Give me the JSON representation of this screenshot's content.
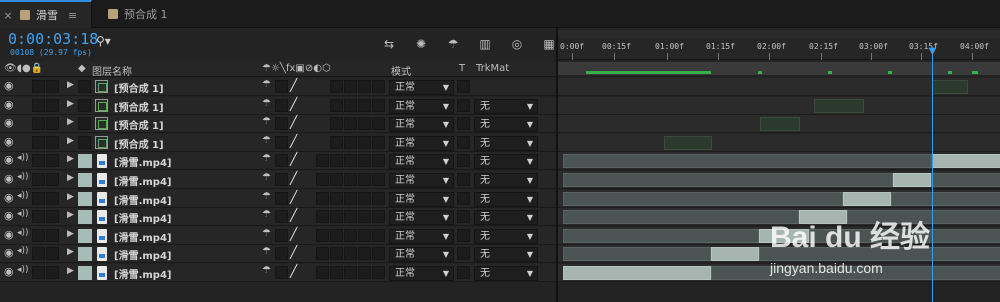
{
  "tabs": [
    {
      "label": "滑雪",
      "close": "×",
      "menu": "≡"
    },
    {
      "label": "预合成 1"
    }
  ],
  "header": {
    "timecode": "0:00:03:18",
    "frames": "00108 (29.97 fps)",
    "search_icon": "search-icon"
  },
  "columns": {
    "layer_name": "图层名称",
    "mode": "模式",
    "t": "T",
    "trkmat": "TrkMat"
  },
  "timeline": {
    "ticks": [
      "0:00f",
      "00:15f",
      "01:00f",
      "01:15f",
      "02:00f",
      "02:15f",
      "03:00f",
      "03:15f",
      "04:00f"
    ]
  },
  "layers": [
    {
      "name": "[预合成 1]",
      "type": "comp",
      "mode": "正常",
      "trkmat": ""
    },
    {
      "name": "[预合成 1]",
      "type": "comp",
      "mode": "正常",
      "trkmat": "无"
    },
    {
      "name": "[预合成 1]",
      "type": "comp",
      "mode": "正常",
      "trkmat": "无"
    },
    {
      "name": "[预合成 1]",
      "type": "comp",
      "mode": "正常",
      "trkmat": "无"
    },
    {
      "name": "[滑雪.mp4]",
      "type": "video",
      "mode": "正常",
      "trkmat": "无"
    },
    {
      "name": "[滑雪.mp4]",
      "type": "video",
      "mode": "正常",
      "trkmat": "无"
    },
    {
      "name": "[滑雪.mp4]",
      "type": "video",
      "mode": "正常",
      "trkmat": "无"
    },
    {
      "name": "[滑雪.mp4]",
      "type": "video",
      "mode": "正常",
      "trkmat": "无"
    },
    {
      "name": "[滑雪.mp4]",
      "type": "video",
      "mode": "正常",
      "trkmat": "无"
    },
    {
      "name": "[滑雪.mp4]",
      "type": "video",
      "mode": "正常",
      "trkmat": "无"
    },
    {
      "name": "[滑雪.mp4]",
      "type": "video",
      "mode": "正常",
      "trkmat": "无"
    }
  ],
  "watermark": {
    "logo": "Bai du 经验",
    "url": "jingyan.baidu.com"
  },
  "colors": {
    "accent": "#3ea3f4",
    "green_bar": "#35b14a"
  }
}
